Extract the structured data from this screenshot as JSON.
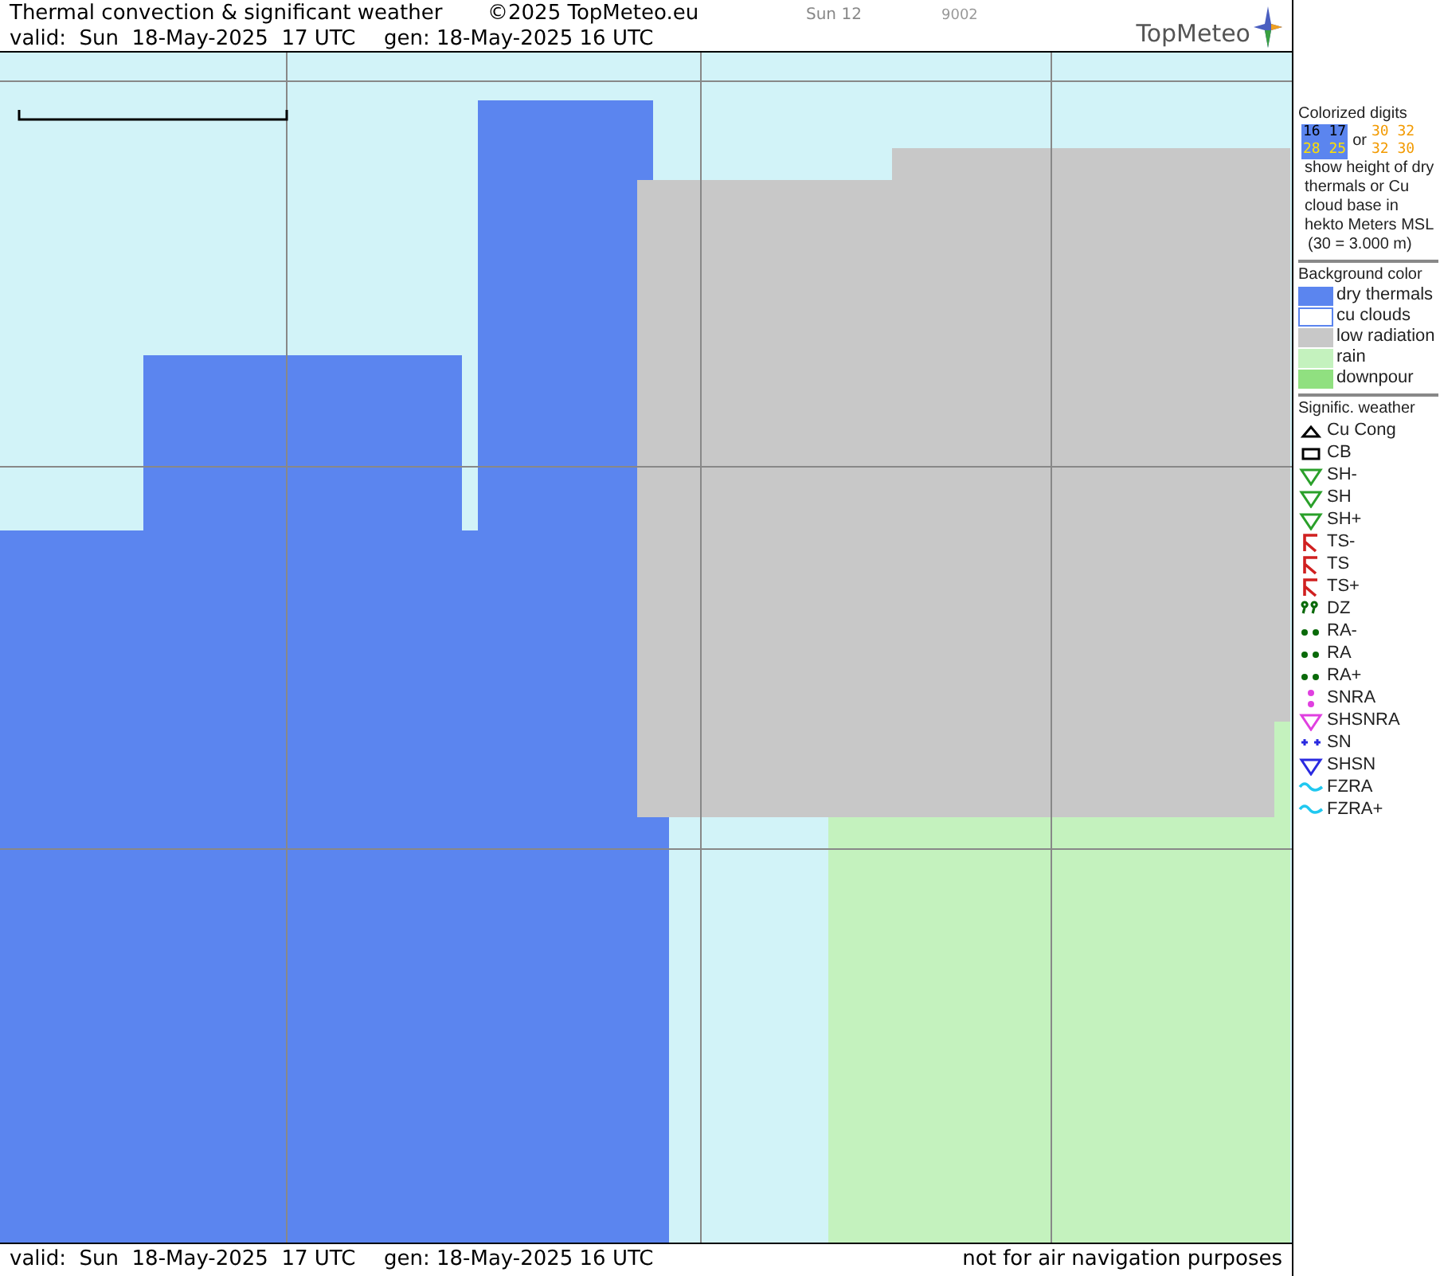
{
  "header": {
    "title": "Thermal convection & significant weather",
    "copyright": "©2025 TopMeteo.eu",
    "run": "Sun 12",
    "code": "9002",
    "valid": "valid:  Sun  18-May-2025  17 UTC",
    "generated": "gen: 18-May-2025 16 UTC",
    "logo": "TopMeteo"
  },
  "footer": {
    "valid": "valid:  Sun  18-May-2025  17 UTC",
    "generated": "gen: 18-May-2025 16 UTC",
    "note": "not for air navigation purposes"
  },
  "legend": {
    "digits_title": "Colorized digits",
    "sample_dry": [
      "16 17",
      "28 25"
    ],
    "or": "or",
    "sample_cu": [
      "30 32",
      "32 30"
    ],
    "digits_text": "show height of dry thermals or Cu cloud base in hekto Meters MSL",
    "digits_example": "(30 = 3.000 m)",
    "background_title": "Background color",
    "backgrounds": [
      {
        "label": "dry thermals",
        "color": "#5b85ef"
      },
      {
        "label": "cu clouds",
        "color": "#ffffff"
      },
      {
        "label": "low radiation",
        "color": "#c8c8c8"
      },
      {
        "label": "rain",
        "color": "#c4f2be"
      },
      {
        "label": "downpour",
        "color": "#90e080"
      }
    ],
    "weather_title": "Signific. weather",
    "weather": [
      {
        "label": "Cu Cong",
        "kind": "cu",
        "color": "#000000"
      },
      {
        "label": "CB",
        "kind": "cb",
        "color": "#000000"
      },
      {
        "label": "SH-",
        "kind": "shower",
        "color": "#2aa02a"
      },
      {
        "label": "SH",
        "kind": "shower",
        "color": "#2aa02a"
      },
      {
        "label": "SH+",
        "kind": "shower",
        "color": "#2aa02a"
      },
      {
        "label": "TS-",
        "kind": "thunder",
        "color": "#d02020"
      },
      {
        "label": "TS",
        "kind": "thunder",
        "color": "#d02020"
      },
      {
        "label": "TS+",
        "kind": "thunder",
        "color": "#d02020"
      },
      {
        "label": "DZ",
        "kind": "drizzle",
        "color": "#0a6a0a"
      },
      {
        "label": "RA-",
        "kind": "rain",
        "color": "#0a6a0a"
      },
      {
        "label": "RA",
        "kind": "rain",
        "color": "#0a6a0a"
      },
      {
        "label": "RA+",
        "kind": "rain",
        "color": "#0a6a0a"
      },
      {
        "label": "SNRA",
        "kind": "snowrain",
        "color": "#e040e0"
      },
      {
        "label": "SHSNRA",
        "kind": "shower",
        "color": "#e040e0"
      },
      {
        "label": "SN",
        "kind": "snow",
        "color": "#2a2ae0"
      },
      {
        "label": "SHSN",
        "kind": "shower",
        "color": "#2a2ae0"
      },
      {
        "label": "FZRA",
        "kind": "freezing",
        "color": "#20c8f0"
      },
      {
        "label": "FZRA+",
        "kind": "freezing",
        "color": "#20c8f0"
      }
    ]
  }
}
